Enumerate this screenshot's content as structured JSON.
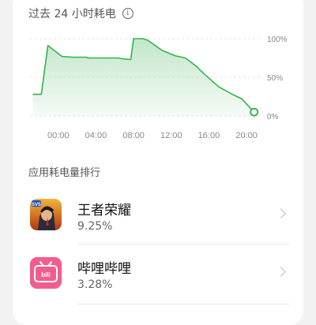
{
  "header": {
    "title": "过去 24 小时耗电"
  },
  "chart_data": {
    "type": "area",
    "x_ticks": [
      "00:00",
      "04:00",
      "08:00",
      "12:00",
      "16:00",
      "20:00"
    ],
    "y_ticks": [
      "100%",
      "50%",
      "0%"
    ],
    "ylim": [
      0,
      100
    ],
    "x_range_hours": [
      -3,
      21.5
    ],
    "grid": true,
    "line_color": "#33b34a",
    "fill_color": "#bfe5c6",
    "points": [
      [
        -2.7,
        28
      ],
      [
        -1.8,
        28
      ],
      [
        -1.1,
        91
      ],
      [
        0.4,
        77
      ],
      [
        1.5,
        76
      ],
      [
        3.0,
        76
      ],
      [
        3.2,
        75
      ],
      [
        6.4,
        75
      ],
      [
        6.8,
        74
      ],
      [
        7.7,
        73
      ],
      [
        8.0,
        100
      ],
      [
        9.0,
        100
      ],
      [
        9.5,
        98
      ],
      [
        11.0,
        85
      ],
      [
        12.4,
        78
      ],
      [
        13.5,
        75
      ],
      [
        14.8,
        63
      ],
      [
        15.0,
        60
      ],
      [
        17.0,
        38
      ],
      [
        18.5,
        28
      ],
      [
        19.5,
        22
      ],
      [
        20.8,
        5
      ]
    ]
  },
  "ranking": {
    "title": "应用耗电量排行",
    "apps": [
      {
        "name": "王者荣耀",
        "percent": "9.25%",
        "icon": "honor-of-kings-icon"
      },
      {
        "name": "哔哩哔哩",
        "percent": "3.28%",
        "icon": "bilibili-icon"
      }
    ]
  }
}
